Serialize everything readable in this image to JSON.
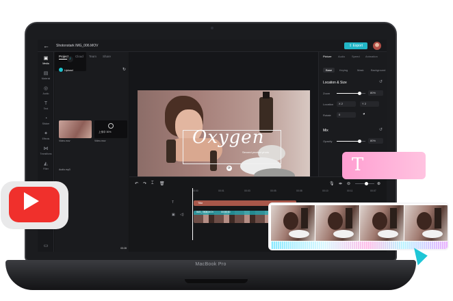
{
  "device": {
    "brand": "MacBook Pro"
  },
  "header": {
    "file_name": "Shotonstark IMG_006.MOV",
    "export_label": "Export"
  },
  "rail": [
    {
      "label": "Media",
      "icon": "media-icon"
    },
    {
      "label": "Material",
      "icon": "material-icon"
    },
    {
      "label": "Audio",
      "icon": "audio-icon"
    },
    {
      "label": "Text",
      "icon": "text-icon"
    },
    {
      "label": "Sticker",
      "icon": "sticker-icon"
    },
    {
      "label": "Effects",
      "icon": "effects-icon"
    },
    {
      "label": "Transitions",
      "icon": "transitions-icon"
    },
    {
      "label": "Filter",
      "icon": "filter-icon"
    }
  ],
  "media_panel": {
    "tabs": [
      "Project",
      "Cloud",
      "Team",
      "Share"
    ],
    "upload_label": "Upload",
    "items": [
      {
        "label": "Video.mov"
      },
      {
        "label": "Video.mov",
        "overlay_text": "上传中 30%"
      },
      {
        "label": "Audio.mp3",
        "duration": "03:28"
      }
    ]
  },
  "preview": {
    "title_text": "Oxygen",
    "subtitle_text": "Second product photo",
    "current_time": "00:02:46",
    "total_time": "00:27:00",
    "quality_label": "Picture quality",
    "ratio_label": "16:9",
    "original_label": "Original",
    "progress": 0.02
  },
  "properties": {
    "tabs": [
      "Picture",
      "Audio",
      "Speed",
      "Animation"
    ],
    "subtabs": [
      "Base",
      "Keying",
      "Mask",
      "Background"
    ],
    "section_location": "Location & Size",
    "zoom_label": "Zoom",
    "zoom_value": "80%",
    "zoom_level": 0.8,
    "location_label": "Location",
    "x_prefix": "X",
    "y_prefix": "Y",
    "x_value": "2",
    "y_value": "2",
    "rotate_label": "Rotate",
    "rotate_value": "0",
    "section_mix": "Mix",
    "opacity_label": "Opacity",
    "opacity_value": "80%",
    "opacity_level": 0.8
  },
  "timeline": {
    "ruler": [
      "00:00",
      "00:01",
      "00:03",
      "00:05",
      "00:08",
      "00:10",
      "00:11",
      "00:07",
      "00:09"
    ],
    "title_clip": "Title",
    "video_clip_name": "IMG_7808.MOV",
    "video_clip_time": "00:00:30"
  },
  "overlays": {
    "text_tool_glyph": "T",
    "play_glyph": "▶"
  },
  "colors": {
    "accent": "#22b6c6",
    "youtube": "#f0302c",
    "text_card": "#ff9ed1",
    "title_clip": "#a8574a"
  }
}
